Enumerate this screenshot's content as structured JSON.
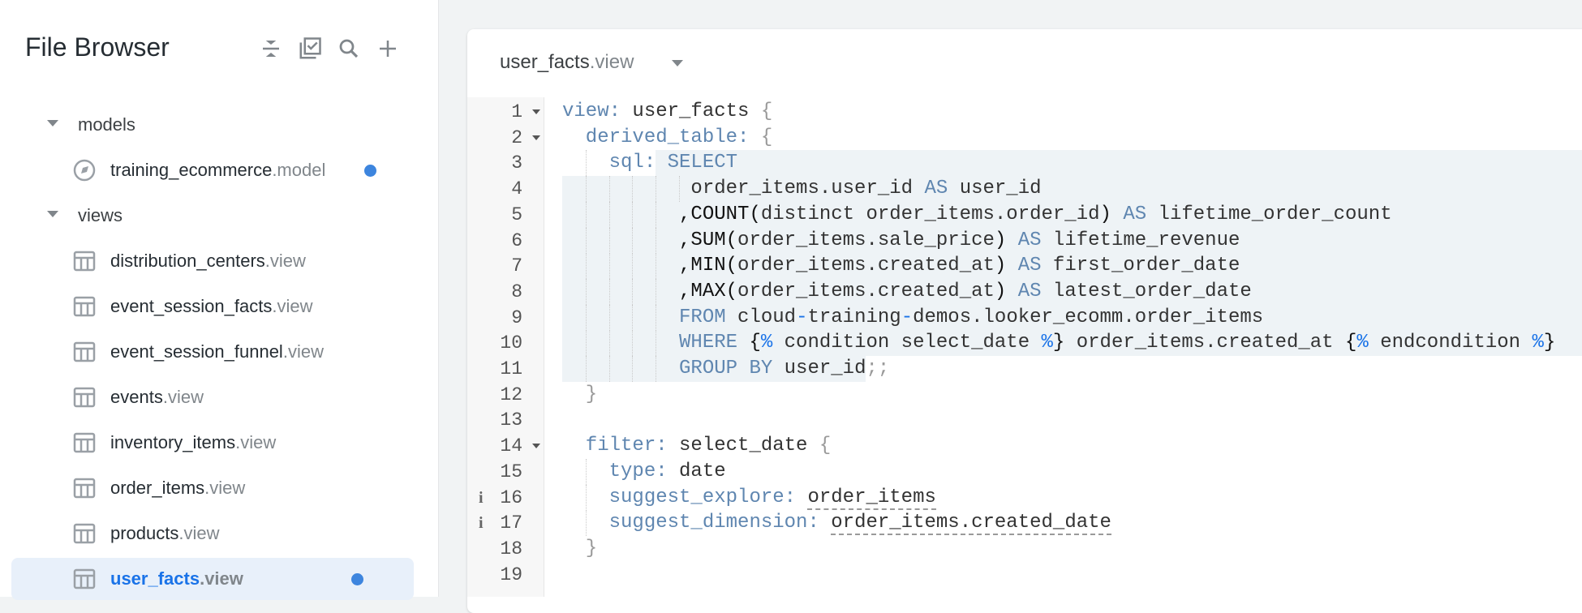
{
  "sidebar": {
    "title": "File Browser",
    "toolbar_icons": [
      "collapse-all-icon",
      "select-files-icon",
      "search-icon",
      "add-icon"
    ],
    "folders": [
      {
        "label": "models"
      },
      {
        "label": "views"
      }
    ],
    "model_file": {
      "name": "training_ecommerce",
      "ext": ".model",
      "unsaved": true
    },
    "view_files": [
      {
        "name": "distribution_centers",
        "ext": ".view"
      },
      {
        "name": "event_session_facts",
        "ext": ".view"
      },
      {
        "name": "event_session_funnel",
        "ext": ".view"
      },
      {
        "name": "events",
        "ext": ".view"
      },
      {
        "name": "inventory_items",
        "ext": ".view"
      },
      {
        "name": "order_items",
        "ext": ".view"
      },
      {
        "name": "products",
        "ext": ".view"
      },
      {
        "name": "user_facts",
        "ext": ".view",
        "selected": true,
        "unsaved": true
      }
    ]
  },
  "editor": {
    "file_name": "user_facts",
    "file_ext": ".view",
    "accent_color": "#3d85de",
    "lines": [
      {
        "n": 1,
        "fold": true,
        "tokens": [
          [
            "view:",
            "k"
          ],
          [
            " user_facts ",
            "t"
          ],
          [
            "{",
            "p"
          ]
        ]
      },
      {
        "n": 2,
        "fold": true,
        "tokens": [
          [
            "  derived_table: ",
            "k"
          ],
          [
            "{",
            "p"
          ]
        ]
      },
      {
        "n": 3,
        "tokens": [
          [
            "    sql: SELECT",
            "k"
          ]
        ]
      },
      {
        "n": 4,
        "tokens": [
          [
            "           order_items.user_id ",
            "t"
          ],
          [
            "AS",
            "k"
          ],
          [
            " user_id",
            "t"
          ]
        ]
      },
      {
        "n": 5,
        "tokens": [
          [
            "          ,COUNT(",
            "f"
          ],
          [
            "distinct order_items.order_id",
            "t"
          ],
          [
            ")",
            "f"
          ],
          [
            " AS",
            "k"
          ],
          [
            " lifetime_order_count",
            "t"
          ]
        ]
      },
      {
        "n": 6,
        "tokens": [
          [
            "          ,SUM(",
            "f"
          ],
          [
            "order_items.sale_price",
            "t"
          ],
          [
            ")",
            "f"
          ],
          [
            " AS",
            "k"
          ],
          [
            " lifetime_revenue",
            "t"
          ]
        ]
      },
      {
        "n": 7,
        "tokens": [
          [
            "          ,MIN(",
            "f"
          ],
          [
            "order_items.created_at",
            "t"
          ],
          [
            ")",
            "f"
          ],
          [
            " AS",
            "k"
          ],
          [
            " first_order_date",
            "t"
          ]
        ]
      },
      {
        "n": 8,
        "tokens": [
          [
            "          ,MAX(",
            "f"
          ],
          [
            "order_items.created_at",
            "t"
          ],
          [
            ")",
            "f"
          ],
          [
            " AS",
            "k"
          ],
          [
            " latest_order_date",
            "t"
          ]
        ]
      },
      {
        "n": 9,
        "tokens": [
          [
            "          FROM ",
            "k"
          ],
          [
            "cloud",
            "t"
          ],
          [
            "-",
            "b"
          ],
          [
            "training",
            "t"
          ],
          [
            "-",
            "b"
          ],
          [
            "demos.looker_ecomm.order_items",
            "t"
          ]
        ]
      },
      {
        "n": 10,
        "tokens": [
          [
            "          WHERE ",
            "k"
          ],
          [
            "{",
            "f"
          ],
          [
            "%",
            "b"
          ],
          [
            " condition select_date ",
            "t"
          ],
          [
            "%",
            "b"
          ],
          [
            "}",
            "f"
          ],
          [
            " order_items.created_at ",
            "t"
          ],
          [
            "{",
            "f"
          ],
          [
            "%",
            "b"
          ],
          [
            " endcondition ",
            "t"
          ],
          [
            "%",
            "b"
          ],
          [
            "}",
            "f"
          ]
        ]
      },
      {
        "n": 11,
        "tokens": [
          [
            "          GROUP BY ",
            "k"
          ],
          [
            "user_id",
            "t"
          ],
          [
            ";;",
            "p"
          ]
        ]
      },
      {
        "n": 12,
        "tokens": [
          [
            "  }",
            "p"
          ]
        ]
      },
      {
        "n": 13,
        "tokens": []
      },
      {
        "n": 14,
        "fold": true,
        "tokens": [
          [
            "  filter: ",
            "k"
          ],
          [
            "select_date ",
            "t"
          ],
          [
            "{",
            "p"
          ]
        ]
      },
      {
        "n": 15,
        "tokens": [
          [
            "    type: ",
            "k"
          ],
          [
            "date",
            "t"
          ]
        ]
      },
      {
        "n": 16,
        "info": true,
        "tokens": [
          [
            "    suggest_explore: ",
            "k"
          ],
          [
            "order_items",
            "u"
          ]
        ]
      },
      {
        "n": 17,
        "info": true,
        "tokens": [
          [
            "    suggest_dimension: ",
            "k"
          ],
          [
            "order_items.created_date",
            "u"
          ]
        ]
      },
      {
        "n": 18,
        "tokens": [
          [
            "  }",
            "p"
          ]
        ]
      },
      {
        "n": 19,
        "tokens": []
      }
    ]
  }
}
